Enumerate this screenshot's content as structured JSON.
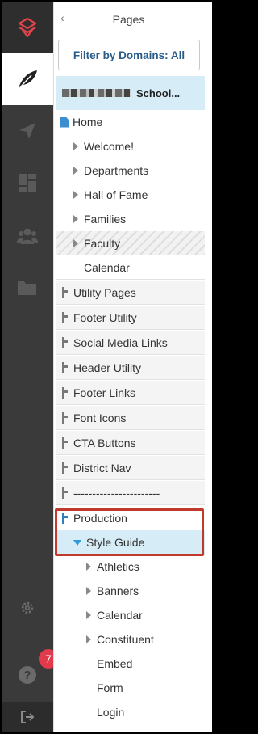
{
  "rail": {
    "colors": {
      "background": "#3a3a3a",
      "logo": "#e0434c",
      "badge": "#e23a4d"
    },
    "items": [
      {
        "icon": "stacked-logo-icon"
      },
      {
        "icon": "feather-icon"
      },
      {
        "icon": "paper-plane-icon"
      },
      {
        "icon": "dashboard-icon"
      },
      {
        "icon": "users-icon"
      },
      {
        "icon": "folder-icon"
      },
      {
        "icon": "gear-icon"
      },
      {
        "icon": "help-icon"
      },
      {
        "icon": "logout-icon"
      }
    ],
    "notification_count": "7"
  },
  "panel": {
    "title": "Pages",
    "filter_button": "Filter by Domains: All",
    "school_name": "School...",
    "tree": [
      {
        "label": "Home",
        "icon": "document-icon"
      },
      {
        "label": "Welcome!"
      },
      {
        "label": "Departments"
      },
      {
        "label": "Hall of Fame"
      },
      {
        "label": "Families"
      },
      {
        "label": "Faculty"
      },
      {
        "label": "Calendar"
      },
      {
        "label": "Utility Pages"
      },
      {
        "label": "Footer Utility"
      },
      {
        "label": "Social Media Links"
      },
      {
        "label": "Header Utility"
      },
      {
        "label": "Footer Links"
      },
      {
        "label": "Font Icons"
      },
      {
        "label": "CTA Buttons"
      },
      {
        "label": "District Nav"
      },
      {
        "label": "-----------------------"
      },
      {
        "label": "Production"
      },
      {
        "label": "Style Guide"
      },
      {
        "label": "Athletics"
      },
      {
        "label": "Banners"
      },
      {
        "label": "Calendar"
      },
      {
        "label": "Constituent"
      },
      {
        "label": "Embed"
      },
      {
        "label": "Form"
      },
      {
        "label": "Login"
      }
    ],
    "colors": {
      "accent": "#2a5c8a",
      "selected_bg": "#d6edf7",
      "highlight_border": "#c0392b"
    }
  }
}
